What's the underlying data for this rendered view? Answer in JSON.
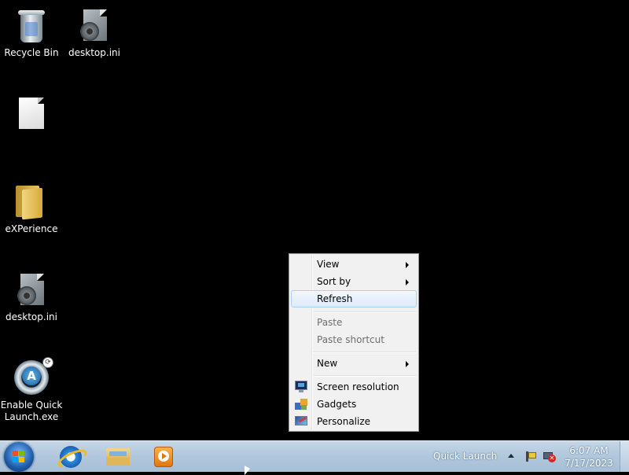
{
  "desktop": {
    "icons": [
      {
        "label": "Recycle Bin",
        "icon": "recycle-bin-icon"
      },
      {
        "label": "desktop.ini",
        "icon": "settings-file-icon"
      },
      {
        "label": "",
        "icon": "blank-file-icon"
      },
      {
        "label": "eXPerience",
        "icon": "folder-icon"
      },
      {
        "label": "desktop.ini",
        "icon": "settings-file-icon"
      },
      {
        "label": "Enable Quick Launch.exe",
        "icon": "quick-launch-app-icon"
      }
    ]
  },
  "context_menu": {
    "items": [
      {
        "label": "View",
        "submenu": true,
        "enabled": true
      },
      {
        "label": "Sort by",
        "submenu": true,
        "enabled": true
      },
      {
        "label": "Refresh",
        "highlighted": true,
        "enabled": true
      },
      {
        "label": "Paste",
        "enabled": false
      },
      {
        "label": "Paste shortcut",
        "enabled": false
      },
      {
        "label": "New",
        "submenu": true,
        "enabled": true
      },
      {
        "label": "Screen resolution",
        "icon": "monitor-icon",
        "enabled": true
      },
      {
        "label": "Gadgets",
        "icon": "gadgets-icon",
        "enabled": true
      },
      {
        "label": "Personalize",
        "icon": "personalize-icon",
        "enabled": true
      }
    ]
  },
  "taskbar": {
    "start_icon": "windows-start-icon",
    "pinned": [
      {
        "icon": "internet-explorer-icon"
      },
      {
        "icon": "file-explorer-icon"
      },
      {
        "icon": "media-player-icon"
      }
    ],
    "quick_launch_label": "Quick Launch",
    "tray": {
      "icons": [
        "show-hidden-icons-arrow",
        "action-center-icon",
        "network-disconnected-icon"
      ],
      "time": "6:07 AM",
      "date": "7/17/2023"
    }
  },
  "colors": {
    "desktop_background": "#000000",
    "taskbar": "#b2c8dd",
    "menu_background": "#f1f1f1",
    "menu_highlight": "#dcebfc"
  }
}
